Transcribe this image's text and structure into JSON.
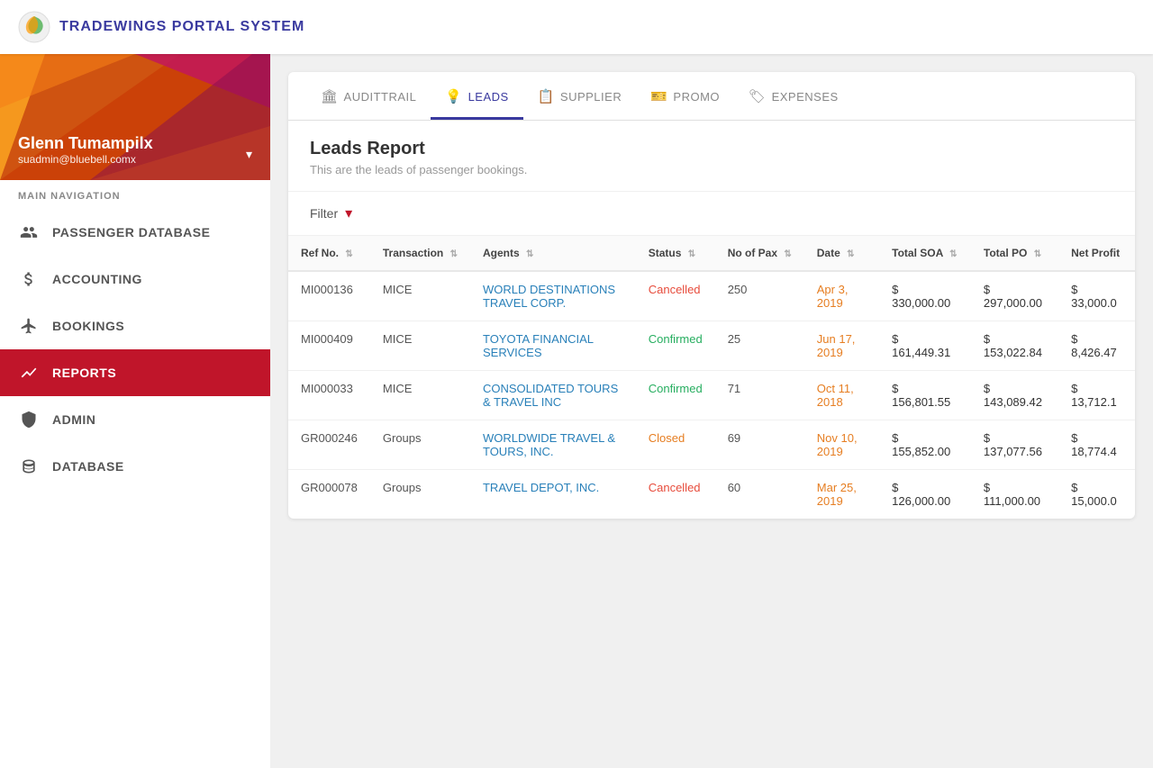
{
  "app": {
    "title": "TRADEWINGS PORTAL SYSTEM"
  },
  "sidebar": {
    "user": {
      "name": "Glenn Tumampilx",
      "email": "suadmin@bluebell.comx"
    },
    "nav_label": "MAIN NAVIGATION",
    "items": [
      {
        "id": "passenger-database",
        "label": "PASSENGER DATABASE",
        "icon": "people",
        "active": false
      },
      {
        "id": "accounting",
        "label": "ACCOUNTING",
        "icon": "dollar",
        "active": false
      },
      {
        "id": "bookings",
        "label": "BOOKINGS",
        "icon": "plane",
        "active": false
      },
      {
        "id": "reports",
        "label": "REPORTS",
        "icon": "chart",
        "active": true
      },
      {
        "id": "admin",
        "label": "ADMIN",
        "icon": "shield",
        "active": false
      },
      {
        "id": "database",
        "label": "DATABASE",
        "icon": "database",
        "active": false
      }
    ]
  },
  "tabs": [
    {
      "id": "audittrail",
      "label": "AUDITTRAIL",
      "icon": "🏛",
      "active": false
    },
    {
      "id": "leads",
      "label": "LEADS",
      "icon": "💡",
      "active": true
    },
    {
      "id": "supplier",
      "label": "SUPPLIER",
      "icon": "📋",
      "active": false
    },
    {
      "id": "promo",
      "label": "PROMO",
      "icon": "🎫",
      "active": false
    },
    {
      "id": "expenses",
      "label": "EXPENSES",
      "icon": "🏷",
      "active": false
    }
  ],
  "report": {
    "title": "Leads Report",
    "subtitle": "This are the leads of passenger bookings."
  },
  "filter": {
    "label": "Filter"
  },
  "table": {
    "columns": [
      {
        "id": "ref-no",
        "label": "Ref No."
      },
      {
        "id": "transaction",
        "label": "Transaction"
      },
      {
        "id": "agents",
        "label": "Agents"
      },
      {
        "id": "status",
        "label": "Status"
      },
      {
        "id": "no-of-pax",
        "label": "No of Pax"
      },
      {
        "id": "date",
        "label": "Date"
      },
      {
        "id": "total-soa",
        "label": "Total SOA"
      },
      {
        "id": "total-po",
        "label": "Total PO"
      },
      {
        "id": "net-profit",
        "label": "Net Profit"
      }
    ],
    "rows": [
      {
        "ref_no": "MI000136",
        "transaction": "MICE",
        "agent": "WORLD DESTINATIONS TRAVEL CORP.",
        "status": "Cancelled",
        "status_class": "status-cancelled",
        "pax": "250",
        "date": "Apr 3, 2019",
        "total_soa": "$ 330,000.00",
        "total_po": "$ 297,000.00",
        "net_profit": "$ 33,000.0"
      },
      {
        "ref_no": "MI000409",
        "transaction": "MICE",
        "agent": "TOYOTA FINANCIAL SERVICES",
        "status": "Confirmed",
        "status_class": "status-confirmed",
        "pax": "25",
        "date": "Jun 17, 2019",
        "total_soa": "$ 161,449.31",
        "total_po": "$ 153,022.84",
        "net_profit": "$ 8,426.47"
      },
      {
        "ref_no": "MI000033",
        "transaction": "MICE",
        "agent": "CONSOLIDATED TOURS & TRAVEL INC",
        "status": "Confirmed",
        "status_class": "status-confirmed",
        "pax": "71",
        "date": "Oct 11, 2018",
        "total_soa": "$ 156,801.55",
        "total_po": "$ 143,089.42",
        "net_profit": "$ 13,712.1"
      },
      {
        "ref_no": "GR000246",
        "transaction": "Groups",
        "agent": "WORLDWIDE TRAVEL & TOURS, INC.",
        "status": "Closed",
        "status_class": "status-closed",
        "pax": "69",
        "date": "Nov 10, 2019",
        "total_soa": "$ 155,852.00",
        "total_po": "$ 137,077.56",
        "net_profit": "$ 18,774.4"
      },
      {
        "ref_no": "GR000078",
        "transaction": "Groups",
        "agent": "TRAVEL DEPOT, INC.",
        "status": "Cancelled",
        "status_class": "status-cancelled",
        "pax": "60",
        "date": "Mar 25, 2019",
        "total_soa": "$ 126,000.00",
        "total_po": "$ 111,000.00",
        "net_profit": "$ 15,000.0"
      }
    ]
  }
}
